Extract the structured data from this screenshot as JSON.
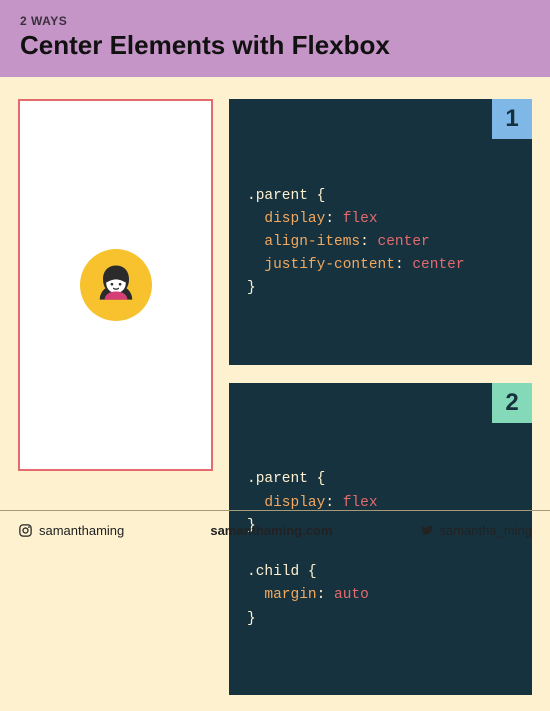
{
  "header": {
    "eyebrow": "2 WAYS",
    "title": "Center Elements with Flexbox"
  },
  "code_blocks": [
    {
      "badge": "1",
      "lines": [
        {
          "selector": ".parent",
          "open": true
        },
        {
          "prop": "display",
          "val": "flex"
        },
        {
          "prop": "align-items",
          "val": "center"
        },
        {
          "prop": "justify-content",
          "val": "center"
        },
        {
          "close": true
        }
      ]
    },
    {
      "badge": "2",
      "lines": [
        {
          "selector": ".parent",
          "open": true
        },
        {
          "prop": "display",
          "val": "flex"
        },
        {
          "close": true
        },
        {
          "blank": true
        },
        {
          "selector": ".child",
          "open": true
        },
        {
          "prop": "margin",
          "val": "auto"
        },
        {
          "close": true
        }
      ]
    }
  ],
  "footer": {
    "instagram": "samanthaming",
    "website": "samanthaming.com",
    "twitter": "samantha_ming"
  }
}
